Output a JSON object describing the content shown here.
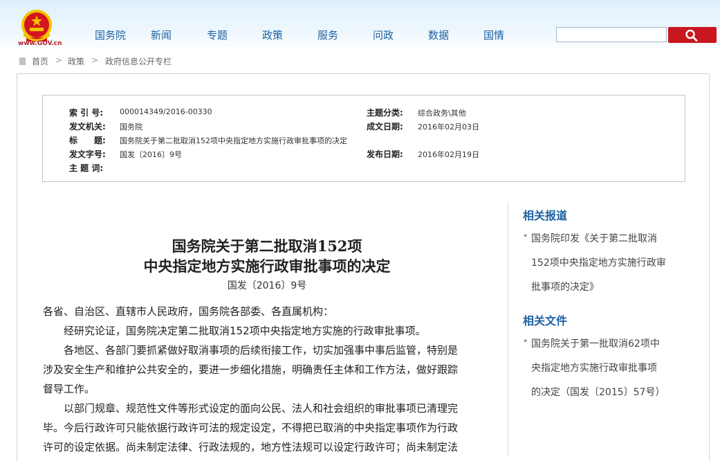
{
  "header": {
    "logo_text": "www.GOV.cn",
    "nav": [
      "国务院",
      "新闻",
      "专题",
      "政策",
      "服务",
      "问政",
      "数据",
      "国情"
    ],
    "search": {
      "value": "",
      "placeholder": ""
    }
  },
  "breadcrumb": [
    "首页",
    "政策",
    "政府信息公开专栏"
  ],
  "meta": {
    "index_no_label": "索 引 号:",
    "index_no": "000014349/2016-00330",
    "category_label": "主题分类:",
    "category": "综合政务\\其他",
    "issuer_label": "发文机关:",
    "issuer": "国务院",
    "date_written_label": "成文日期:",
    "date_written": "2016年02月03日",
    "title_label": "标　　题:",
    "title": "国务院关于第二批取消152项中央指定地方实施行政审批事项的决定",
    "doc_no_label": "发文字号:",
    "doc_no": "国发〔2016〕9号",
    "publish_date_label": "发布日期:",
    "publish_date": "2016年02月19日",
    "keywords_label": "主 题 词:",
    "keywords": ""
  },
  "article": {
    "title_line1": "国务院关于第二批取消152项",
    "title_line2": "中央指定地方实施行政审批事项的决定",
    "doc_no": "国发〔2016〕9号",
    "paragraphs": [
      "各省、自治区、直辖市人民政府，国务院各部委、各直属机构：",
      "经研究论证，国务院决定第二批取消152项中央指定地方实施的行政审批事项。",
      "各地区、各部门要抓紧做好取消事项的后续衔接工作，切实加强事中事后监管，特别是",
      "涉及安全生产和维护公共安全的，要进一步细化措施，明确责任主体和工作方法，做好跟踪",
      "督导工作。",
      "以部门规章、规范性文件等形式设定的面向公民、法人和社会组织的审批事项已清理完",
      "毕。今后行政许可只能依据行政许可法的规定设定，不得把已取消的中央指定事项作为行政",
      "许可的设定依据。尚未制定法律、行政法规的，地方性法规可以设定行政许可；尚未制定法"
    ]
  },
  "sidebar": {
    "related_reports_title": "相关报道",
    "related_reports": [
      [
        "国务院印发《关于第二批取消",
        "152项中央指定地方实施行政审",
        "批事项的决定》"
      ]
    ],
    "related_docs_title": "相关文件",
    "related_docs": [
      [
        "国务院关于第一批取消62项中",
        "央指定地方实施行政审批事项",
        "的决定（国发〔2015〕57号）"
      ]
    ]
  },
  "colors": {
    "nav_blue": "#1d61a3",
    "search_red": "#c8171e",
    "emblem_red": "#c8171e",
    "emblem_gold": "#f3c300"
  }
}
